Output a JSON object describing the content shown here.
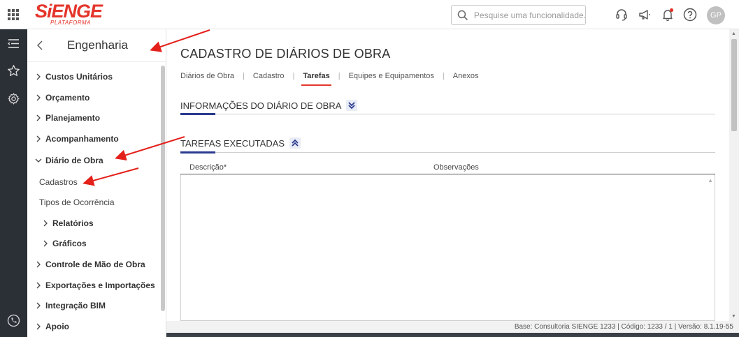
{
  "brand": {
    "logo_text": "SiENGE",
    "logo_sub": "PLATAFORMA",
    "accent_color": "#e4352b",
    "dark_rail_color": "#2b2f36"
  },
  "topbar": {
    "search_placeholder": "Pesquise uma funcionalidade.",
    "avatar_initials": "GP",
    "icons": [
      "apps-grid-icon",
      "search-icon",
      "headset-icon",
      "megaphone-icon",
      "bell-icon",
      "help-icon"
    ]
  },
  "sidebar": {
    "title": "Engenharia",
    "items": [
      {
        "label": "Custos Unitários",
        "expanded": false,
        "level": 0
      },
      {
        "label": "Orçamento",
        "expanded": false,
        "level": 0
      },
      {
        "label": "Planejamento",
        "expanded": false,
        "level": 0
      },
      {
        "label": "Acompanhamento",
        "expanded": false,
        "level": 0
      },
      {
        "label": "Diário de Obra",
        "expanded": true,
        "level": 0
      },
      {
        "label": "Cadastros",
        "level": 1
      },
      {
        "label": "Tipos de Ocorrência",
        "level": 1
      },
      {
        "label": "Relatórios",
        "expanded": false,
        "level": 1
      },
      {
        "label": "Gráficos",
        "expanded": false,
        "level": 1
      },
      {
        "label": "Controle de Mão de Obra",
        "expanded": false,
        "level": 0
      },
      {
        "label": "Exportações e Importações",
        "expanded": false,
        "level": 0
      },
      {
        "label": "Integração BIM",
        "expanded": false,
        "level": 0
      },
      {
        "label": "Apoio",
        "expanded": false,
        "level": 0
      }
    ]
  },
  "main": {
    "title": "CADASTRO DE DIÁRIOS DE OBRA",
    "tabs": [
      {
        "label": "Diários de Obra",
        "active": false
      },
      {
        "label": "Cadastro",
        "active": false
      },
      {
        "label": "Tarefas",
        "active": true
      },
      {
        "label": "Equipes e Equipamentos",
        "active": false
      },
      {
        "label": "Anexos",
        "active": false
      }
    ],
    "section_info": {
      "title": "INFORMAÇÕES DO DIÁRIO DE OBRA",
      "collapsed": true
    },
    "section_tasks": {
      "title": "TAREFAS EXECUTADAS",
      "collapsed": false
    },
    "table": {
      "columns": [
        "Descrição*",
        "Observações"
      ],
      "rows": []
    }
  },
  "footer": {
    "text": "Base: Consultoria SIENGE 1233 | Código: 1233 / 1 | Versão: 8.1.19-55"
  }
}
